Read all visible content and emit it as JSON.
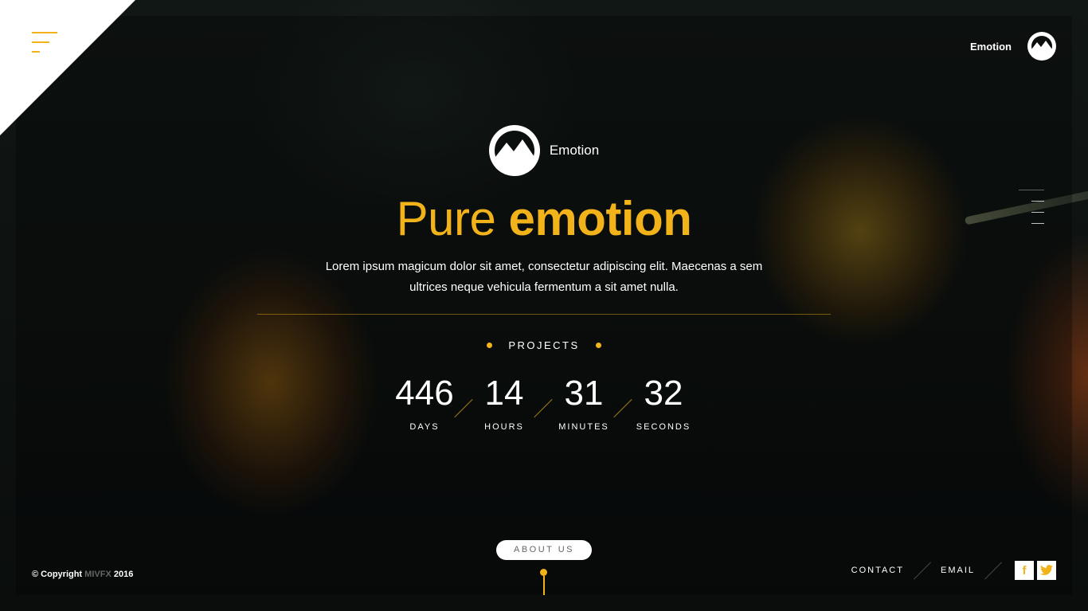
{
  "brand": {
    "name": "Emotion"
  },
  "hero": {
    "headline_regular": "Pure",
    "headline_bold": "emotion",
    "description": "Lorem ipsum magicum dolor sit amet, consectetur adipiscing elit. Maecenas a sem ultrices neque vehicula fermentum a sit amet nulla."
  },
  "projects": {
    "label": "PROJECTS"
  },
  "countdown": [
    {
      "value": "446",
      "label": "DAYS"
    },
    {
      "value": "14",
      "label": "HOURS"
    },
    {
      "value": "31",
      "label": "MINUTES"
    },
    {
      "value": "32",
      "label": "SECONDS"
    }
  ],
  "about_button": "ABOUT US",
  "footer": {
    "copyright_prefix": "© Copyright",
    "copyright_brand": "MIVFX",
    "copyright_year": "2016",
    "links": [
      "CONTACT",
      "EMAIL"
    ],
    "social": [
      {
        "icon": "facebook-icon",
        "glyph": "f"
      },
      {
        "icon": "twitter-icon",
        "glyph": "t"
      }
    ]
  },
  "colors": {
    "accent": "#f2b21a",
    "background": "#0b0f0d"
  },
  "icons": {
    "menu": "hamburger-menu-icon",
    "logo": "mountain-logo-icon",
    "side_nav": "slide-nav-dashes"
  }
}
